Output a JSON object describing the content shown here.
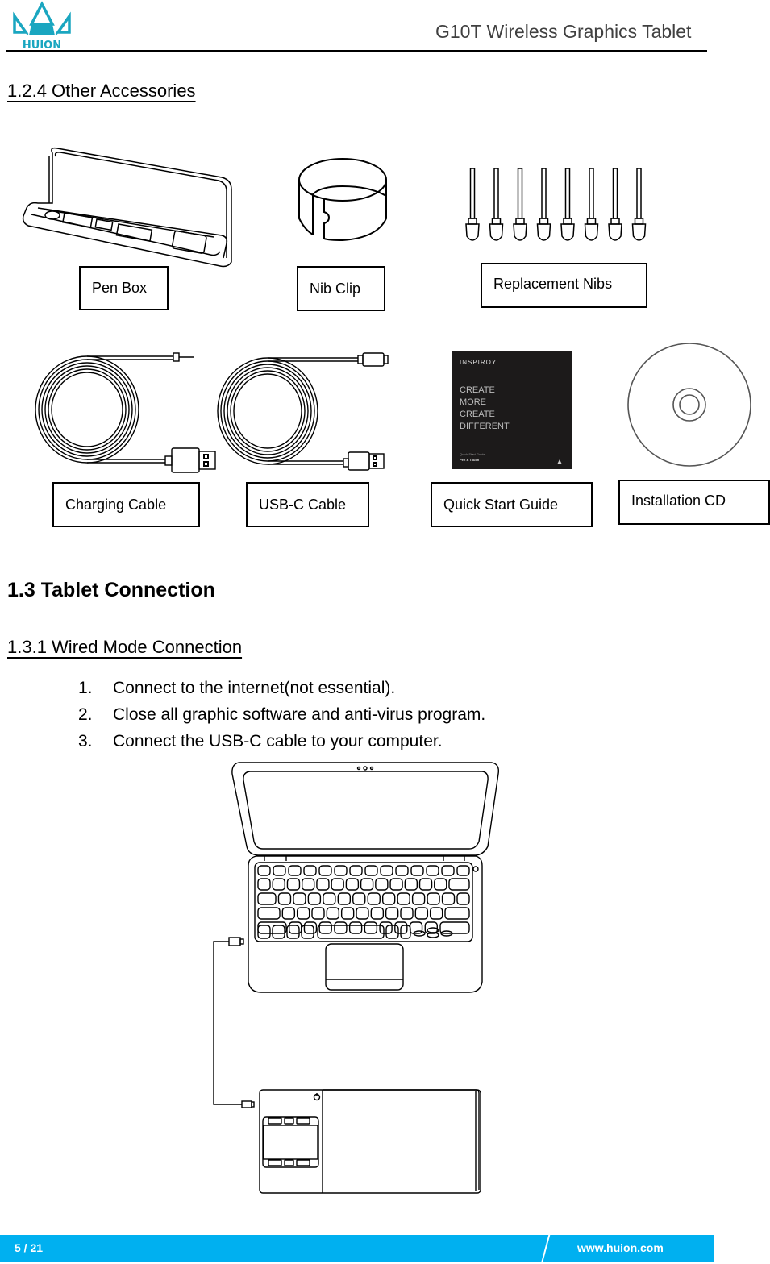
{
  "header": {
    "brand": "HUION",
    "doc_title": "G10T Wireless Graphics Tablet",
    "brand_color": "#1aa6c0"
  },
  "section_124": {
    "heading": "1.2.4 Other Accessories",
    "items": [
      {
        "label": "Pen Box",
        "icon": "pen-box-icon"
      },
      {
        "label": "Nib Clip",
        "icon": "nib-clip-icon"
      },
      {
        "label": "Replacement Nibs",
        "icon": "replacement-nibs-icon",
        "count": 8
      },
      {
        "label": "Charging Cable",
        "icon": "charging-cable-icon"
      },
      {
        "label": "USB-C Cable",
        "icon": "usb-c-cable-icon"
      },
      {
        "label": "Quick Start Guide",
        "icon": "quick-start-guide-icon"
      },
      {
        "label": "Installation CD",
        "icon": "installation-cd-icon"
      }
    ],
    "guide_cover": {
      "brand": "INSPIROY",
      "lines": [
        "CREATE",
        "MORE",
        "CREATE",
        "DIFFERENT"
      ],
      "subtitle": "Quick Start Guide",
      "product": "Pen & Touch"
    }
  },
  "section_13": {
    "heading": "1.3 Tablet Connection"
  },
  "section_131": {
    "heading": "1.3.1 Wired Mode Connection",
    "steps": [
      {
        "num": "1.",
        "text": "Connect to the internet(not essential)."
      },
      {
        "num": "2.",
        "text": "Close all graphic software and anti-virus program."
      },
      {
        "num": "3.",
        "text": "Connect the USB-C cable to your computer."
      }
    ]
  },
  "footer": {
    "page": "5 / 21",
    "url": "www.huion.com",
    "color": "#00b0f0"
  }
}
